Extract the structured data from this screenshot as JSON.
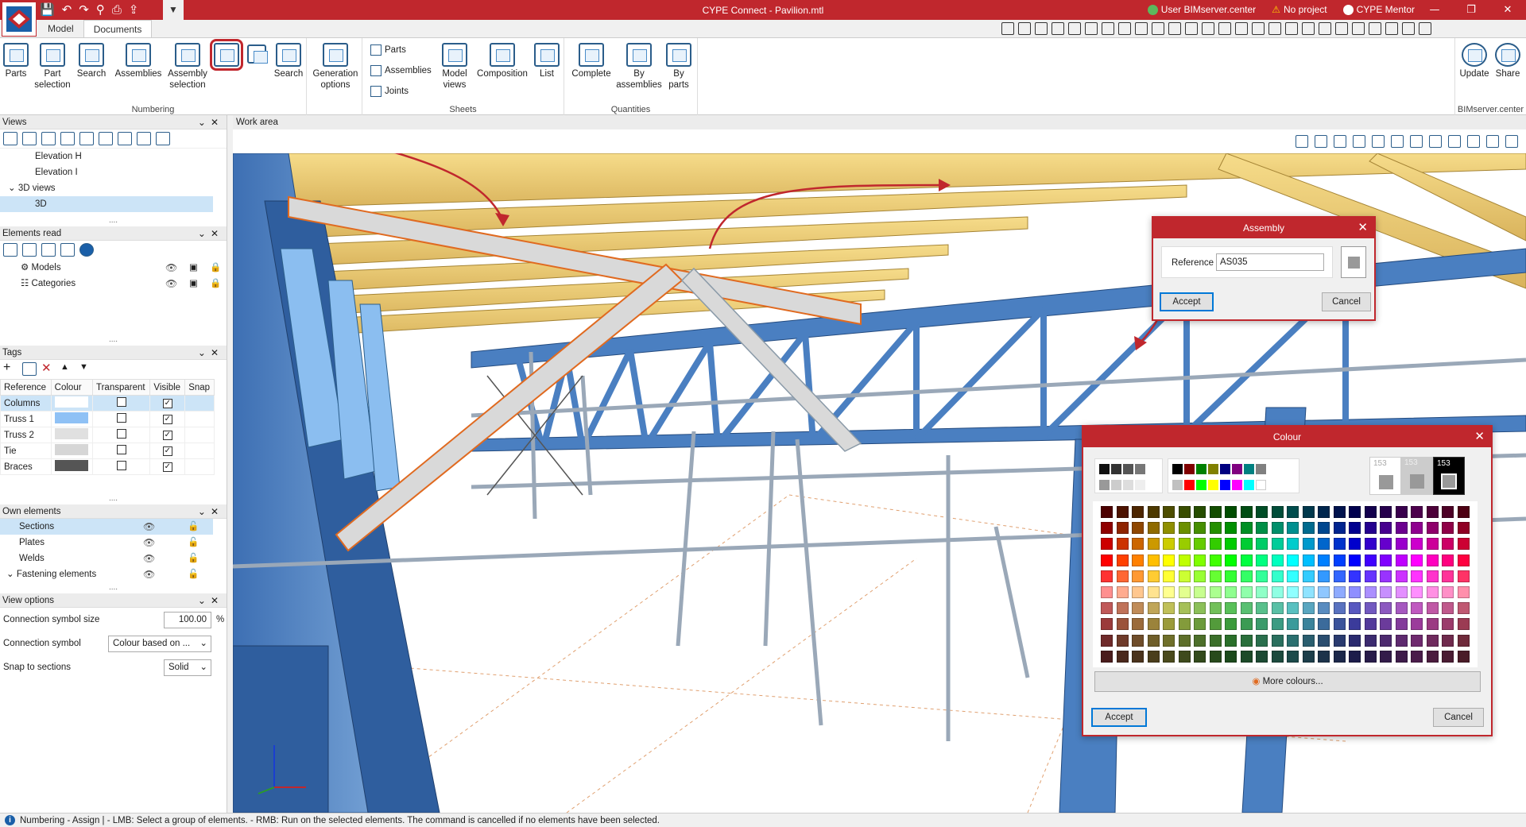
{
  "app": {
    "title": "CYPE Connect - Pavilion.mtl",
    "user": "User BIMserver.center",
    "project": "No project",
    "mentor": "CYPE Mentor"
  },
  "tabs": [
    "Model",
    "Documents"
  ],
  "ribbon": {
    "numbering": {
      "label": "Numbering",
      "buttons": [
        "Parts",
        "Part selection",
        "Search",
        "Assemblies",
        "Assembly selection",
        "Search"
      ]
    },
    "generation": {
      "label": "Generation options"
    },
    "sheets": {
      "label": "Sheets",
      "small": [
        "Parts",
        "Assemblies",
        "Joints"
      ],
      "buttons": [
        "Model views",
        "Composition",
        "List"
      ]
    },
    "quantities": {
      "label": "Quantities",
      "buttons": [
        "Complete",
        "By assemblies",
        "By parts"
      ]
    },
    "bimserver": {
      "label": "BIMserver.center",
      "buttons": [
        "Update",
        "Share"
      ]
    }
  },
  "views_panel": {
    "title": "Views",
    "items": [
      "Elevation H",
      "Elevation I",
      "3D views",
      "3D"
    ]
  },
  "elements_read": {
    "title": "Elements read",
    "items": [
      "Models",
      "Categories"
    ]
  },
  "tags": {
    "title": "Tags",
    "columns": [
      "Reference",
      "Colour",
      "Transparent",
      "Visible",
      "Snap"
    ],
    "rows": [
      {
        "reference": "Columns",
        "colour": "#ffffff",
        "transparent": false,
        "visible": true
      },
      {
        "reference": "Truss 1",
        "colour": "#8fc1f5",
        "transparent": false,
        "visible": true
      },
      {
        "reference": "Truss 2",
        "colour": "#e0e0e0",
        "transparent": false,
        "visible": true
      },
      {
        "reference": "Tie",
        "colour": "#d6d6d6",
        "transparent": false,
        "visible": true
      },
      {
        "reference": "Braces",
        "colour": "#555555",
        "transparent": false,
        "visible": true
      }
    ]
  },
  "own_elements": {
    "title": "Own elements",
    "items": [
      "Sections",
      "Plates",
      "Welds",
      "Fastening elements"
    ]
  },
  "view_options": {
    "title": "View options",
    "connection_symbol_size_label": "Connection symbol size",
    "connection_symbol_size_value": "100.00",
    "connection_symbol_size_unit": "%",
    "connection_symbol_label": "Connection symbol",
    "connection_symbol_value": "Colour based on ...",
    "snap_label": "Snap to sections",
    "snap_value": "Solid"
  },
  "work_area": {
    "title": "Work area"
  },
  "assembly_dialog": {
    "title": "Assembly",
    "reference_label": "Reference",
    "reference_value": "AS035",
    "accept": "Accept",
    "cancel": "Cancel"
  },
  "colour_dialog": {
    "title": "Colour",
    "more_colours": "More colours...",
    "accept": "Accept",
    "cancel": "Cancel",
    "shade_values": [
      "153",
      "153",
      "153"
    ]
  },
  "status": {
    "text": "Numbering - Assign  |  - LMB: Select a group of elements. - RMB: Run on the selected elements. The command is cancelled if no elements have been selected."
  },
  "colors": {
    "brand": "#c0272d",
    "steel_blue": "#4a7fc1",
    "timber": "#f0d080",
    "selection": "#cce4f7"
  }
}
